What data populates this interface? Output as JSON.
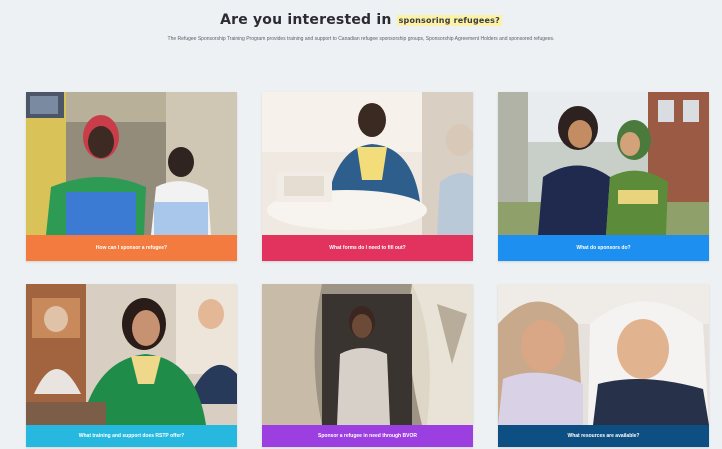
{
  "header": {
    "title": "Are you interested in",
    "title_highlight": "sponsoring refugees?",
    "subtitle": "The Refugee Sponsorship Training Program provides training and support to Canadian refugee sponsorship groups, Sponsorship Agreement Holders and sponsored refugees."
  },
  "cards": [
    {
      "caption": "How can I sponsor a refugee?",
      "caption_color": "#f47b3f",
      "image": "woman-and-child-photo"
    },
    {
      "caption": "What forms do I need to fill out?",
      "caption_color": "#e2335f",
      "image": "man-at-desk-photo"
    },
    {
      "caption": "What do sponsors do?",
      "caption_color": "#1c8ff0",
      "image": "two-women-hugging-photo"
    },
    {
      "caption": "What training and support does RSTP offer?",
      "caption_color": "#27b8e0",
      "image": "woman-in-classroom-photo"
    },
    {
      "caption": "Sponsor a refugee in need through BVOR",
      "caption_color": "#9b3fe0",
      "image": "girl-in-tent-photo"
    },
    {
      "caption": "What resources are available?",
      "caption_color": "#0d4f82",
      "image": "women-in-hijab-photo"
    }
  ]
}
